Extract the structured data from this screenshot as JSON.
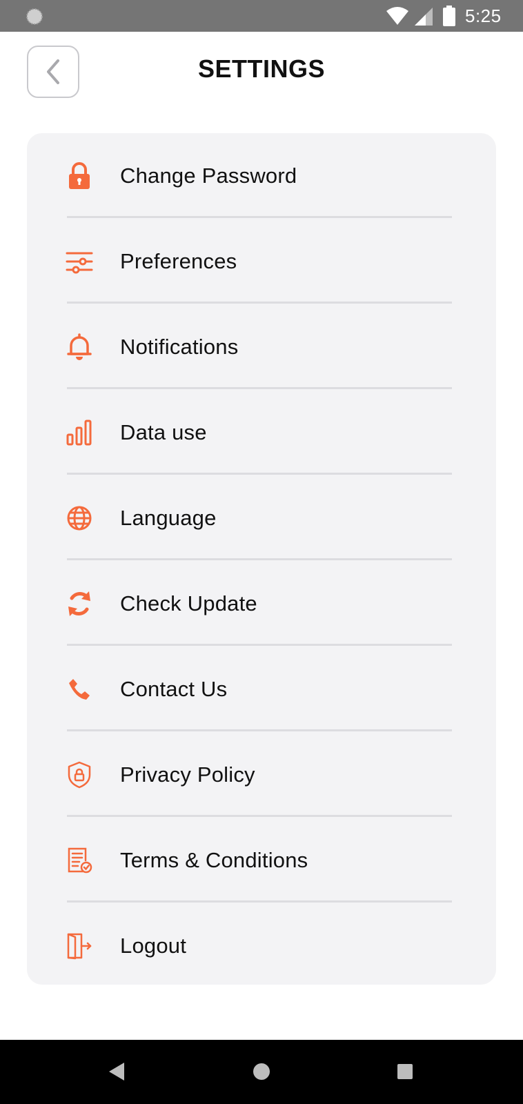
{
  "status_bar": {
    "time": "5:25",
    "icons": [
      "loading-spinner-icon",
      "wifi-icon",
      "cell-signal-icon",
      "battery-icon"
    ]
  },
  "header": {
    "title": "SETTINGS",
    "back_icon": "chevron-left-icon"
  },
  "colors": {
    "accent": "#f46a3c",
    "card_background": "#f3f3f5",
    "divider": "#dcdce0",
    "text": "#111111"
  },
  "menu": {
    "items": [
      {
        "label": "Change Password",
        "icon": "lock-icon"
      },
      {
        "label": "Preferences",
        "icon": "sliders-icon"
      },
      {
        "label": "Notifications",
        "icon": "bell-icon"
      },
      {
        "label": "Data use",
        "icon": "bar-chart-icon"
      },
      {
        "label": "Language",
        "icon": "globe-icon"
      },
      {
        "label": "Check Update",
        "icon": "refresh-icon"
      },
      {
        "label": "Contact Us",
        "icon": "phone-icon"
      },
      {
        "label": "Privacy Policy",
        "icon": "shield-lock-icon"
      },
      {
        "label": "Terms & Conditions",
        "icon": "document-check-icon"
      },
      {
        "label": "Logout",
        "icon": "logout-icon"
      }
    ]
  },
  "nav_bar": {
    "icons": [
      "back-triangle-icon",
      "home-circle-icon",
      "recents-square-icon"
    ]
  }
}
